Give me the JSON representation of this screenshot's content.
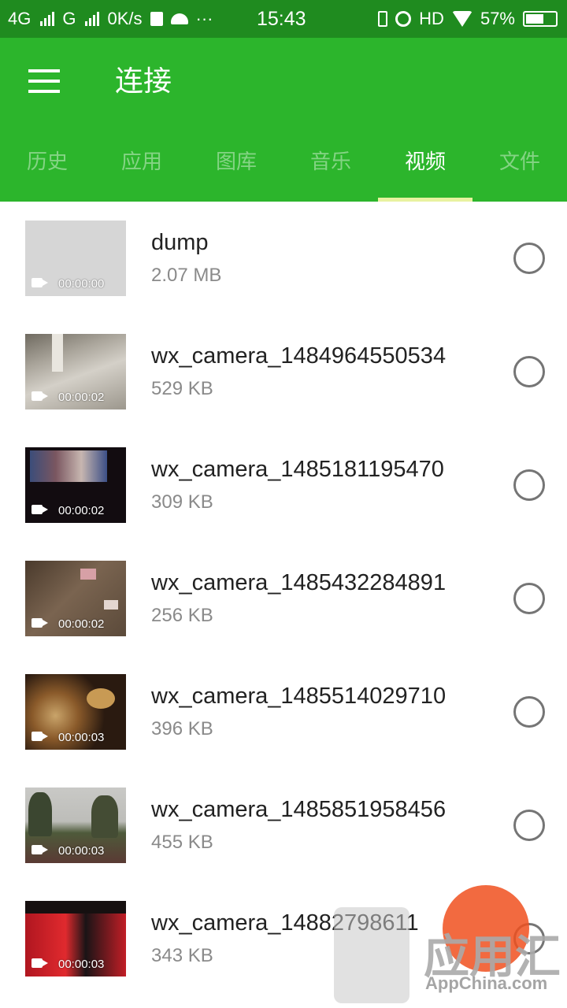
{
  "status_bar": {
    "network_1": "4G",
    "network_2": "G",
    "speed": "0K/s",
    "dots": "···",
    "time": "15:43",
    "hd": "HD",
    "battery": "57%"
  },
  "app_bar": {
    "title": "连接"
  },
  "tabs": [
    {
      "label": "历史",
      "active": false
    },
    {
      "label": "应用",
      "active": false
    },
    {
      "label": "图库",
      "active": false
    },
    {
      "label": "音乐",
      "active": false
    },
    {
      "label": "视频",
      "active": true
    },
    {
      "label": "文件",
      "active": false
    }
  ],
  "videos": [
    {
      "name": "dump",
      "size": "2.07 MB",
      "duration": "00:00:00"
    },
    {
      "name": "wx_camera_1484964550534",
      "size": "529 KB",
      "duration": "00:00:02"
    },
    {
      "name": "wx_camera_1485181195470",
      "size": "309 KB",
      "duration": "00:00:02"
    },
    {
      "name": "wx_camera_1485432284891",
      "size": "256 KB",
      "duration": "00:00:02"
    },
    {
      "name": "wx_camera_1485514029710",
      "size": "396 KB",
      "duration": "00:00:03"
    },
    {
      "name": "wx_camera_1485851958456",
      "size": "455 KB",
      "duration": "00:00:03"
    },
    {
      "name": "wx_camera_14882798611",
      "size": "343 KB",
      "duration": "00:00:03"
    }
  ],
  "watermark": {
    "brand": "应用汇",
    "site": "AppChina.com"
  },
  "colors": {
    "status_bar": "#1f8b1f",
    "app_bar": "#2cb52c",
    "tab_indicator": "#e8f2a0"
  }
}
